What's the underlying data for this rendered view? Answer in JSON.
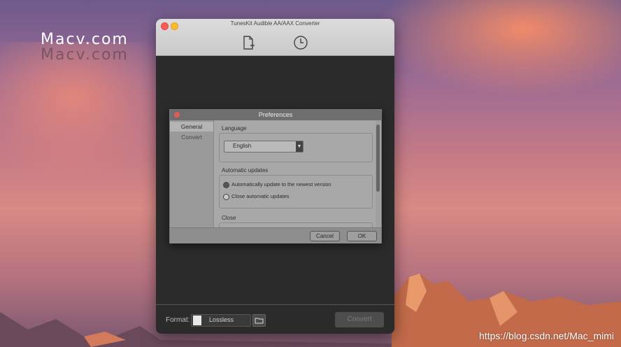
{
  "watermark": {
    "brand": "Macv.com",
    "brand_shadow": "Macv.com",
    "url": "https://blog.csdn.net/Mac_mimi"
  },
  "app": {
    "title": "TunesKit Audible AA/AAX Converter",
    "toolbar": {
      "add_icon": "add-file-icon",
      "history_icon": "history-clock-icon"
    },
    "bottom": {
      "format_label": "Format:",
      "format_value": "Lossless",
      "convert_label": "Convert"
    }
  },
  "preferences": {
    "title": "Preferences",
    "sidebar": [
      {
        "label": "General"
      },
      {
        "label": "Convert"
      }
    ],
    "language": {
      "label": "Language",
      "selected": "English"
    },
    "updates": {
      "label": "Automatic updates",
      "options": [
        {
          "label": "Automatically update to the newest version",
          "selected": true
        },
        {
          "label": "Close automatic updates",
          "selected": false
        }
      ]
    },
    "close": {
      "label": "Close"
    },
    "buttons": {
      "cancel": "Cancel",
      "ok": "OK"
    }
  },
  "colors": {
    "window_bg": "#2b2b2b",
    "dialog_bg": "#a8a8a8",
    "close_red": "#fc5b57",
    "minimize_yellow": "#fdbb2d"
  }
}
